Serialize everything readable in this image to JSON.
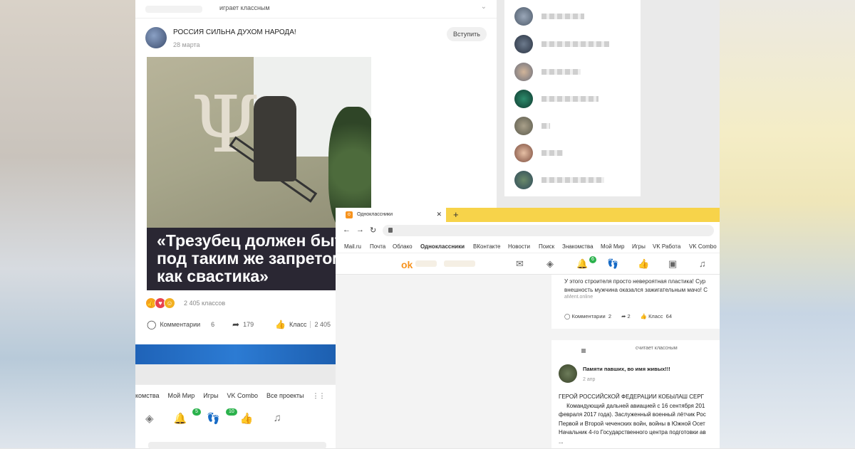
{
  "feed": {
    "top_text": "играет классным",
    "post": {
      "group_title": "РОССИЯ СИЛЬНА ДУХОМ НАРОДА!",
      "date": "28 марта",
      "join_label": "Вступить",
      "caption": "«Трезубец должен быть\nпод таким же запретом,\nкак свастика»",
      "classes_text": "2 405 классов",
      "comments_label": "Комментарии",
      "comments_count": "6",
      "shares_count": "179",
      "likes_label": "Класс",
      "likes_count": "2 405"
    }
  },
  "bottom_nav": {
    "links": [
      "комства",
      "Мой Мир",
      "Игры",
      "VK Combo",
      "Все проекты"
    ],
    "badge1": "5",
    "badge2": "10"
  },
  "browser": {
    "tab_title": "Одноклассники",
    "bookmarks": [
      "Mail.ru",
      "Почта",
      "Облако",
      "Одноклассники",
      "ВКонтакте",
      "Новости",
      "Поиск",
      "Знакомства",
      "Мой Мир",
      "Игры",
      "VK Работа",
      "VK Combo"
    ],
    "notif_badge": "6",
    "card1": {
      "text_line1": "У этого строителя просто невероятная пластика! Сур",
      "text_line2": "внешность мужчина оказался зажигательным мачо! С",
      "source": "аМеnt.online",
      "comments_label": "Комментарии",
      "comments_count": "2",
      "shares_count": "2",
      "likes_label": "Класс",
      "likes_count": "64"
    },
    "card2": {
      "header": "считает классным",
      "group_name": "Памяти павших, во имя живых!!!",
      "date": "2 апр",
      "body": "ГЕРОЙ РОССИЙСКОЙ ФЕДЕРАЦИИ КОБЫЛАШ СЕРГ\n     Командующий дальней авиацией с 16 сентября 201\nфевраля 2017 года). Заслуженный военный лётчик Рос\nПервой и Второй чеченских войн, войны в Южной Осет\nНачальник 4-го Государственного центра подготовки ав\n..."
    }
  }
}
